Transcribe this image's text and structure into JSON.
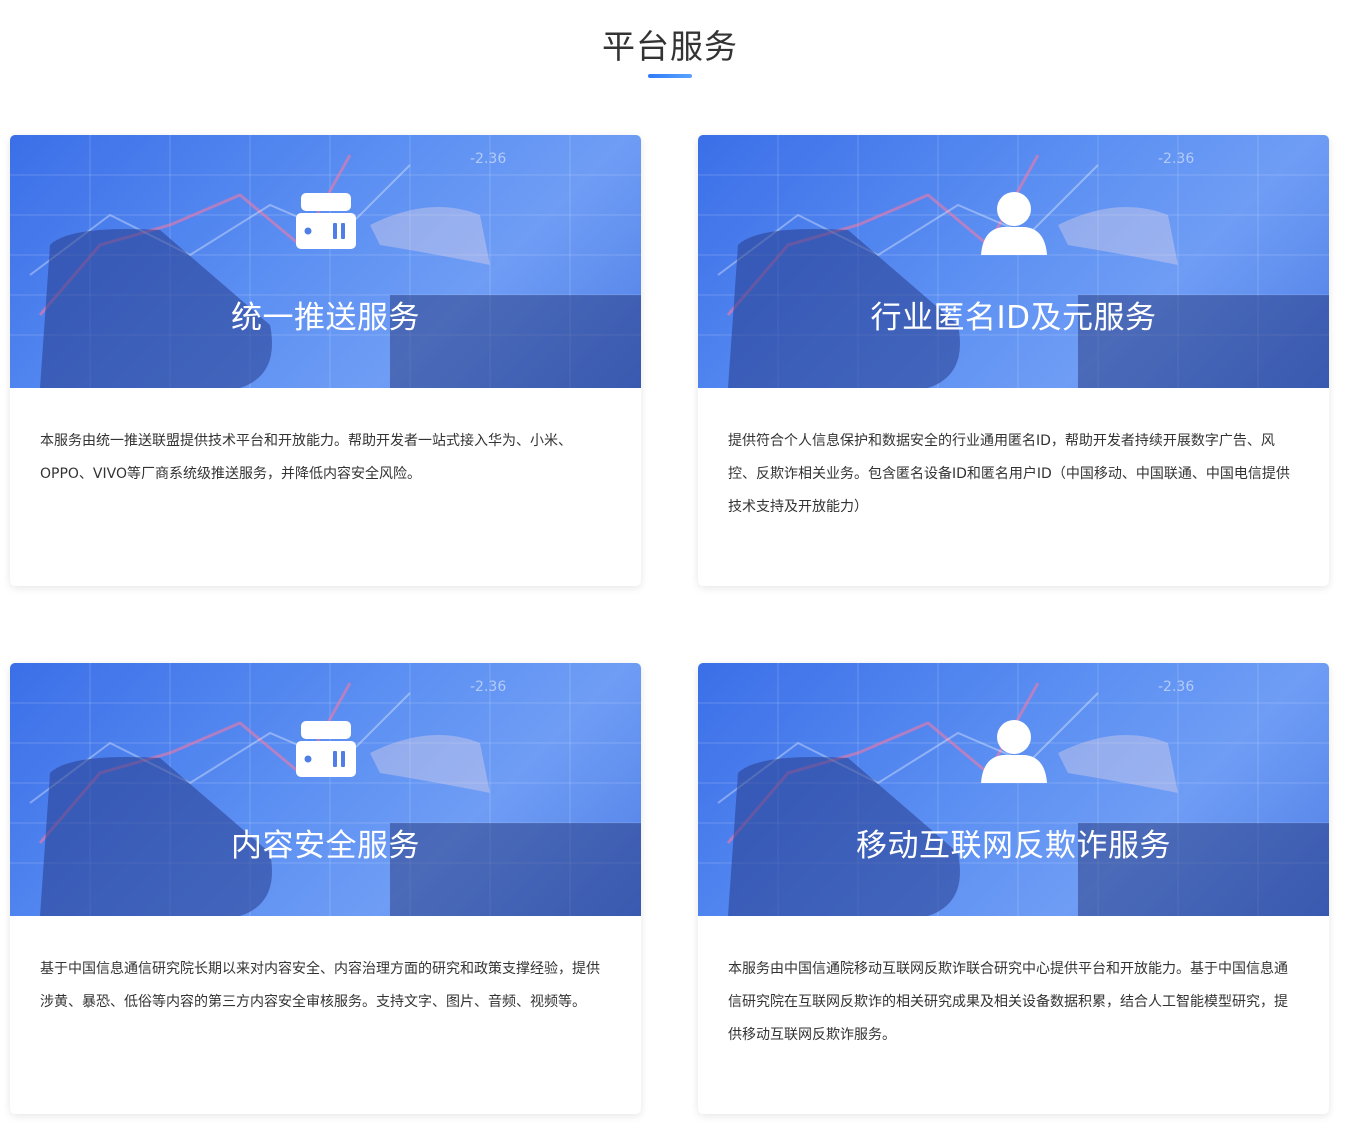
{
  "section": {
    "title": "平台服务"
  },
  "colors": {
    "accent": "#2e7cf6",
    "banner": "#4f7fe6"
  },
  "cards": [
    {
      "icon": "server-box-icon",
      "title": "统一推送服务",
      "description": "本服务由统一推送联盟提供技术平台和开放能力。帮助开发者一站式接入华为、小米、OPPO、VIVO等厂商系统级推送服务，并降低内容安全风险。"
    },
    {
      "icon": "user-icon",
      "title": "行业匿名ID及元服务",
      "description": "提供符合个人信息保护和数据安全的行业通用匿名ID，帮助开发者持续开展数字广告、风控、反欺诈相关业务。包含匿名设备ID和匿名用户ID（中国移动、中国联通、中国电信提供技术支持及开放能力）"
    },
    {
      "icon": "server-box-icon",
      "title": "内容安全服务",
      "description": "基于中国信息通信研究院长期以来对内容安全、内容治理方面的研究和政策支撑经验，提供涉黄、暴恐、低俗等内容的第三方内容安全审核服务。支持文字、图片、音频、视频等。"
    },
    {
      "icon": "user-icon",
      "title": "移动互联网反欺诈服务",
      "description": "本服务由中国信通院移动互联网反欺诈联合研究中心提供平台和开放能力。基于中国信息通信研究院在互联网反欺诈的相关研究成果及相关设备数据积累，结合人工智能模型研究，提供移动互联网反欺诈服务。"
    }
  ]
}
